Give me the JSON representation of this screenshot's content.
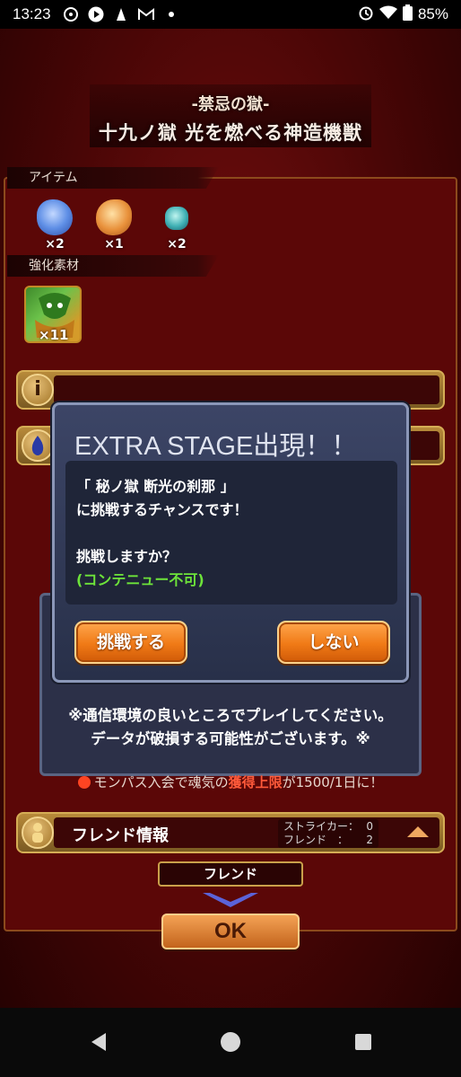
{
  "status_bar": {
    "time": "13:23",
    "battery": "85%"
  },
  "header": {
    "subtitle": "-禁忌の獄-",
    "title": "十九ノ獄 光を燃べる神造機獣"
  },
  "items_section": {
    "label": "アイテム",
    "items": [
      {
        "icon": "blue-crystal-icon",
        "count": "×2"
      },
      {
        "icon": "orange-crystal-icon",
        "count": "×1"
      },
      {
        "icon": "teal-gem-icon",
        "count": "×2"
      }
    ]
  },
  "materials_section": {
    "label": "強化素材",
    "count": "×11"
  },
  "dialog": {
    "title": "EXTRA STAGE出現！！",
    "lines": [
      "「 秘ノ獄 断光の刹那 」",
      "に挑戦するチャンスです！",
      "",
      "挑戦しますか？",
      "(コンテニュー不可)"
    ],
    "accept_label": "挑戦する",
    "decline_label": "しない"
  },
  "background_notice": {
    "line1": "※通信環境の良いところでプレイしてください。",
    "line2": "データが破損する可能性がございます。※"
  },
  "monpass_notice": {
    "prefix": "モンパス入会で魂気の",
    "highlight": "獲得上限",
    "suffix": "が1500/1日に！"
  },
  "friend_section": {
    "label": "フレンド情報",
    "striker_label": "ストライカー：",
    "striker_value": "0",
    "friend_label": "フレンド　：",
    "friend_value": "2",
    "tab_label": "フレンド"
  },
  "ok_label": "OK"
}
